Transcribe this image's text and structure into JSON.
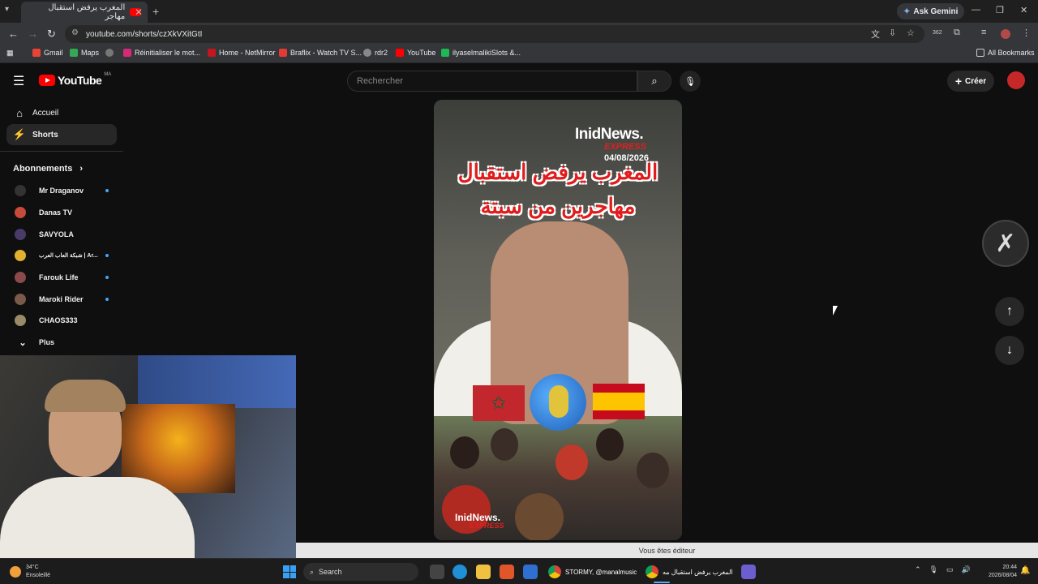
{
  "browser": {
    "tab_title": "المغرب يرفض استقبال مهاجر",
    "url": "youtube.com/shorts/czXkVXitGtI",
    "gemini_label": "Ask Gemini",
    "bookmarks": [
      "Gmail",
      "Maps",
      "Réinitialiser le mot...",
      "Home - NetMirror",
      "Braflix - Watch TV S...",
      "rdr2",
      "YouTube",
      "ilyaselmalikiSlots &..."
    ],
    "all_bookmarks": "All Bookmarks",
    "badge_count": "362"
  },
  "youtube": {
    "logo_text": "YouTube",
    "logo_region": "MA",
    "search_placeholder": "Rechercher",
    "create_label": "Créer",
    "sidebar": {
      "items": [
        {
          "label": "Accueil",
          "icon": "home-icon"
        },
        {
          "label": "Shorts",
          "icon": "shorts-icon"
        }
      ],
      "subscriptions_title": "Abonnements",
      "subscriptions": [
        {
          "name": "Mr Draganov",
          "color": "#333333",
          "new": true
        },
        {
          "name": "Danas TV",
          "color": "#c84a3c",
          "new": false
        },
        {
          "name": "SAVYOLA",
          "color": "#4a3a6a",
          "new": false
        },
        {
          "name": "شبكة العاب العرب | Ar...",
          "color": "#e0b030",
          "new": true
        },
        {
          "name": "Farouk Life",
          "color": "#8a4a4a",
          "new": true
        },
        {
          "name": "Maroki Rider",
          "color": "#7a5a4a",
          "new": true
        },
        {
          "name": "CHAOS333",
          "color": "#9a8a6a",
          "new": false
        }
      ],
      "more_label": "Plus"
    }
  },
  "video": {
    "brand": "InidNews.",
    "brand_sub": "EXPRESS",
    "date": "04/08/2026",
    "headline_line1": "المغرب يرفض استقبال",
    "headline_line2": "مهاجرين من سبتة",
    "watermark": "InidNews.",
    "watermark_sub": "EXPRESS"
  },
  "editor_banner": "Vous êtes éditeur",
  "taskbar": {
    "weather_temp": "34°C",
    "weather_desc": "Ensoleillé",
    "search_label": "Search",
    "win1": "STORMY, @manalmusic",
    "win2": "المغرب يرفض استقبال مه",
    "time": "20:44",
    "date": "2026/08/04"
  }
}
